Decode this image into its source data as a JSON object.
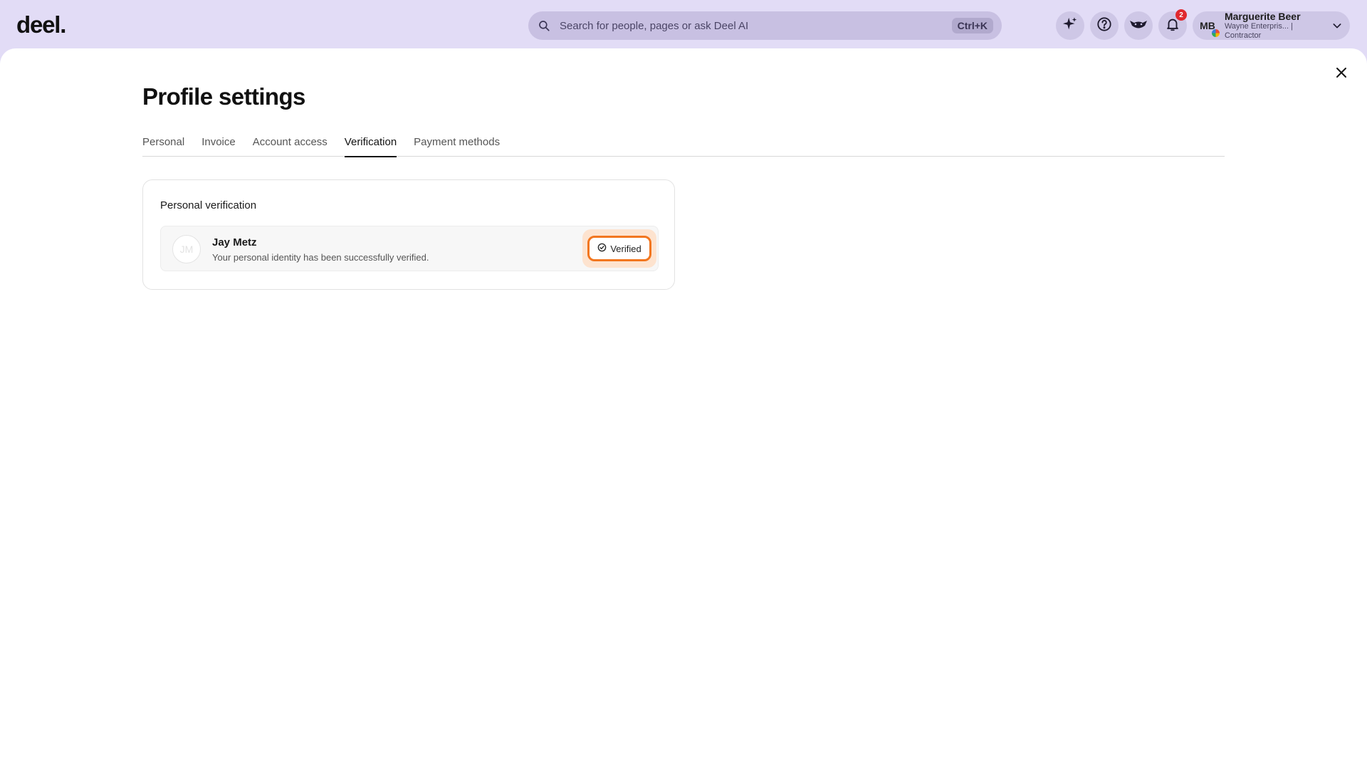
{
  "app": {
    "logo": "deel."
  },
  "search": {
    "placeholder": "Search for people, pages or ask Deel AI",
    "shortcut": "Ctrl+K"
  },
  "notifications": {
    "count": "2"
  },
  "user": {
    "initials": "MB",
    "name": "Marguerite Beer",
    "subtitle": "Wayne Enterpris... | Contractor"
  },
  "page": {
    "title": "Profile settings"
  },
  "tabs": [
    {
      "label": "Personal"
    },
    {
      "label": "Invoice"
    },
    {
      "label": "Account access"
    },
    {
      "label": "Verification",
      "active": true
    },
    {
      "label": "Payment methods"
    }
  ],
  "verification_card": {
    "title": "Personal verification",
    "person": {
      "initials": "JM",
      "name": "Jay Metz",
      "description": "Your personal identity has been successfully verified."
    },
    "status_label": "Verified"
  },
  "colors": {
    "topbar_bg": "#e2dcf6",
    "accent_orange": "#f2761f",
    "badge_red": "#e0282e"
  },
  "icons": [
    "search-icon",
    "ai-sparkle-icon",
    "help-icon",
    "deel-mascot-icon",
    "bell-icon",
    "chevron-down-icon",
    "close-icon",
    "check-circle-icon"
  ]
}
